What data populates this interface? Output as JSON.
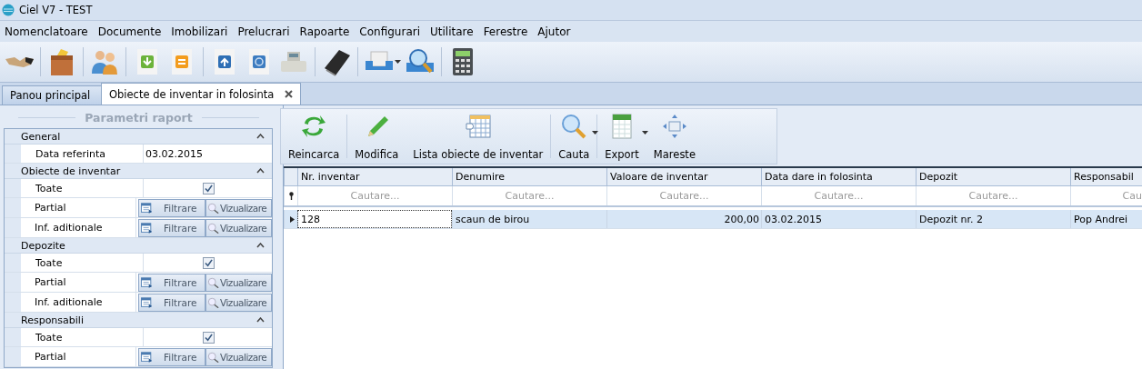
{
  "window": {
    "title": "Ciel V7 - TEST"
  },
  "menu": [
    "Nomenclatoare",
    "Documente",
    "Imobilizari",
    "Prelucrari",
    "Rapoarte",
    "Configurari",
    "Utilitare",
    "Ferestre",
    "Ajutor"
  ],
  "tabs": [
    {
      "label": "Panou principal",
      "selected": false,
      "closable": false
    },
    {
      "label": "Obiecte de inventar in folosinta",
      "selected": true,
      "closable": true
    }
  ],
  "panel": {
    "title": "Parametri raport",
    "groups": [
      {
        "title": "General",
        "expanded": true,
        "rows": [
          {
            "kind": "value",
            "label": "Data referinta",
            "value": "03.02.2015"
          }
        ]
      },
      {
        "title": "Obiecte de inventar",
        "expanded": true,
        "rows": [
          {
            "kind": "checkbox",
            "label": "Toate",
            "checked": true
          },
          {
            "kind": "buttons",
            "label": "Partial",
            "buttons": [
              "Filtrare",
              "Vizualizare"
            ]
          },
          {
            "kind": "buttons",
            "label": "Inf. aditionale",
            "buttons": [
              "Filtrare",
              "Vizualizare"
            ]
          }
        ]
      },
      {
        "title": "Depozite",
        "expanded": true,
        "rows": [
          {
            "kind": "checkbox",
            "label": "Toate",
            "checked": true
          },
          {
            "kind": "buttons",
            "label": "Partial",
            "buttons": [
              "Filtrare",
              "Vizualizare"
            ]
          },
          {
            "kind": "buttons",
            "label": "Inf. aditionale",
            "buttons": [
              "Filtrare",
              "Vizualizare"
            ]
          }
        ]
      },
      {
        "title": "Responsabili",
        "expanded": true,
        "rows": [
          {
            "kind": "checkbox",
            "label": "Toate",
            "checked": true
          },
          {
            "kind": "buttons",
            "label": "Partial",
            "buttons": [
              "Filtrare",
              "Vizualizare"
            ]
          }
        ]
      }
    ]
  },
  "ribbon": [
    {
      "kind": "reload",
      "label": "Reincarca",
      "dropdown": false
    },
    {
      "kind": "edit",
      "label": "Modifica",
      "dropdown": false
    },
    {
      "kind": "list",
      "label": "Lista obiecte de inventar",
      "dropdown": false
    },
    {
      "kind": "search",
      "label": "Cauta",
      "dropdown": true
    },
    {
      "kind": "export",
      "label": "Export",
      "dropdown": true
    },
    {
      "kind": "maximize",
      "label": "Mareste",
      "dropdown": false
    }
  ],
  "grid": {
    "columns": [
      {
        "header": "Nr. inventar",
        "filter_placeholder": "Cautare...",
        "numeric": false
      },
      {
        "header": "Denumire",
        "filter_placeholder": "Cautare...",
        "numeric": false
      },
      {
        "header": "Valoare de inventar",
        "filter_placeholder": "Cautare...",
        "numeric": true
      },
      {
        "header": "Data dare in folosinta",
        "filter_placeholder": "Cautare...",
        "numeric": false
      },
      {
        "header": "Depozit",
        "filter_placeholder": "Cautare...",
        "numeric": false
      },
      {
        "header": "Responsabil",
        "filter_placeholder": "Cau",
        "numeric": false
      }
    ],
    "rows": [
      {
        "selected": true,
        "cells": [
          {
            "text": "128",
            "focused": true
          },
          {
            "text": "scaun de birou",
            "focused": false
          },
          {
            "text": "200,00",
            "focused": false
          },
          {
            "text": "03.02.2015",
            "focused": false
          },
          {
            "text": "Depozit nr. 2",
            "focused": false
          },
          {
            "text": "Pop Andrei",
            "focused": false
          }
        ]
      }
    ]
  }
}
